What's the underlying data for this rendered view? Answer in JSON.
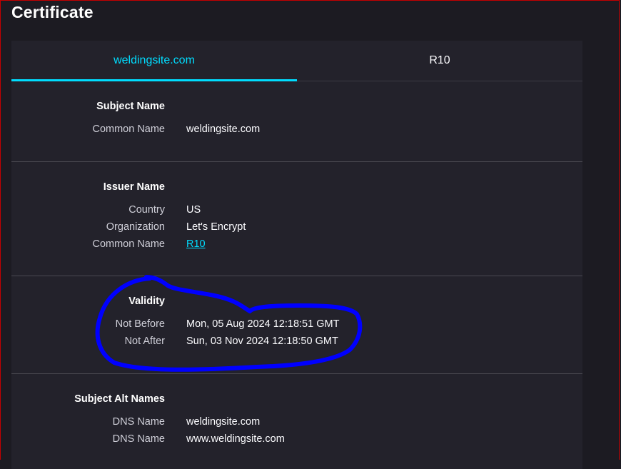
{
  "page": {
    "title": "Certificate"
  },
  "tabs": [
    {
      "label": "weldingsite.com",
      "active": true
    },
    {
      "label": "R10",
      "active": false
    }
  ],
  "sections": {
    "subject": {
      "heading": "Subject Name",
      "rows": [
        {
          "key": "Common Name",
          "value": "weldingsite.com"
        }
      ]
    },
    "issuer": {
      "heading": "Issuer Name",
      "rows": [
        {
          "key": "Country",
          "value": "US"
        },
        {
          "key": "Organization",
          "value": "Let's Encrypt"
        },
        {
          "key": "Common Name",
          "value": "R10"
        }
      ]
    },
    "validity": {
      "heading": "Validity",
      "rows": [
        {
          "key": "Not Before",
          "value": "Mon, 05 Aug 2024 12:18:51 GMT"
        },
        {
          "key": "Not After",
          "value": "Sun, 03 Nov 2024 12:18:50 GMT"
        }
      ]
    },
    "alt_names": {
      "heading": "Subject Alt Names",
      "rows": [
        {
          "key": "DNS Name",
          "value": "weldingsite.com"
        },
        {
          "key": "DNS Name",
          "value": "www.weldingsite.com"
        }
      ]
    }
  },
  "colors": {
    "accent": "#00ddff",
    "background": "#1c1b22",
    "card": "#23222b",
    "annotation": "#0000ff",
    "frame": "#c50000"
  }
}
